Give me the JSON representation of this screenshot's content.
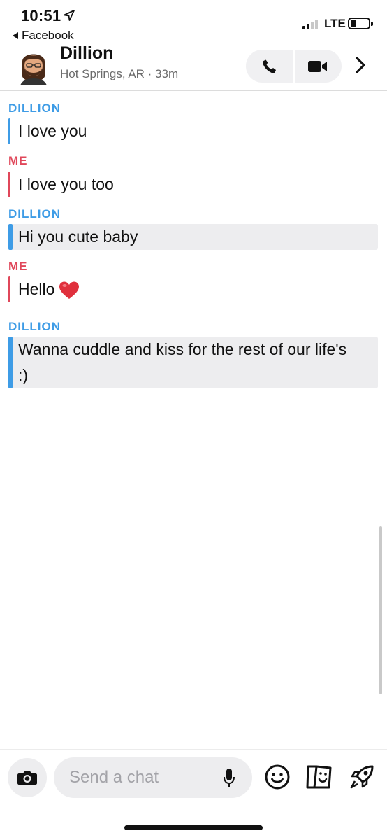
{
  "status_bar": {
    "time": "10:51",
    "back_label": "Facebook",
    "network": "LTE"
  },
  "header": {
    "contact_name": "Dillion",
    "subtitle": "Hot Springs, AR · 33m"
  },
  "messages": [
    {
      "sender": "DILLION",
      "text": "I love you"
    },
    {
      "sender": "ME",
      "text": "I love you too"
    },
    {
      "sender": "DILLION",
      "text": "Hi you cute baby"
    },
    {
      "sender": "ME",
      "text": "Hello"
    },
    {
      "sender": "DILLION",
      "text": "Wanna cuddle and kiss for the rest of our life's :)"
    }
  ],
  "composer": {
    "placeholder": "Send a chat"
  },
  "colors": {
    "friend_accent": "#3e9ce6",
    "me_accent": "#e0475a",
    "saved_bg": "#ededef"
  },
  "icons": [
    "location-arrow-icon",
    "back-triangle-icon",
    "signal-icon",
    "battery-icon",
    "avatar",
    "phone-icon",
    "video-icon",
    "chevron-right-icon",
    "heart-emoji",
    "camera-icon",
    "mic-icon",
    "smiley-icon",
    "stickers-icon",
    "rocket-icon"
  ]
}
